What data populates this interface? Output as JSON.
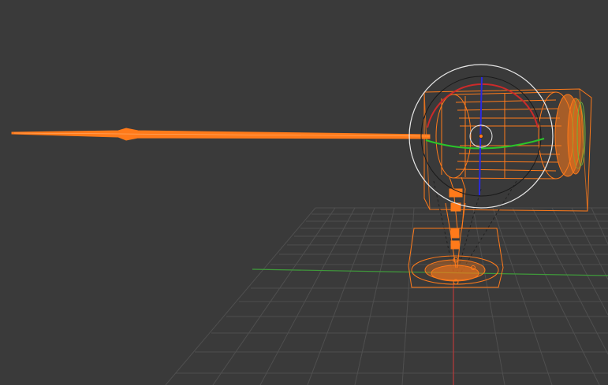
{
  "viewport": {
    "background": "#3a3a3a",
    "grid_color": "#4e4e4e",
    "x_axis_color": "#3f9a3a",
    "y_axis_color": "#b83a3a"
  },
  "object": {
    "name_semantic": "spotlight-lamp-model",
    "display_mode": "wireframe",
    "selection_color": "#ff7a1a",
    "selected": true
  },
  "gizmo": {
    "type": "rotate",
    "colors": {
      "x": "#cc2a2a",
      "y": "#2ac42a",
      "z": "#2a2ae0",
      "view": "#e6e6e6",
      "trackball": "#1a1a1a"
    }
  }
}
